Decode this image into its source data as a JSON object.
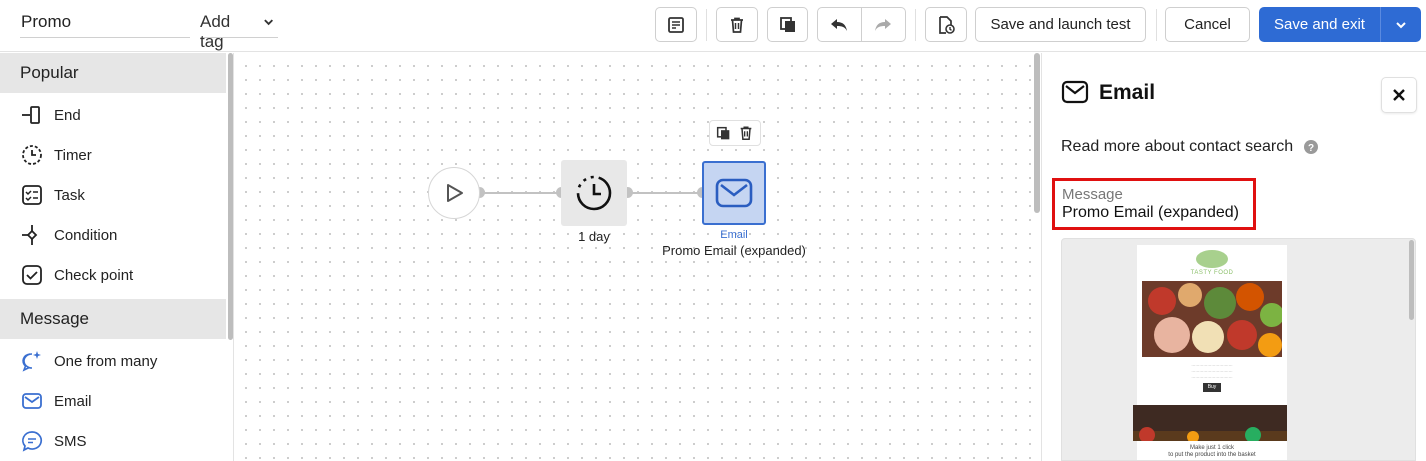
{
  "header": {
    "flow_name": "Promo",
    "add_tag_label": "Add tag",
    "save_launch_label": "Save and launch test",
    "cancel_label": "Cancel",
    "save_exit_label": "Save and exit"
  },
  "palette": {
    "sections": [
      {
        "title": "Popular",
        "items": [
          "End",
          "Timer",
          "Task",
          "Condition",
          "Check point"
        ]
      },
      {
        "title": "Message",
        "items": [
          "One from many",
          "Email",
          "SMS"
        ]
      }
    ]
  },
  "canvas": {
    "timer_label": "1 day",
    "email_type": "Email",
    "email_name": "Promo Email (expanded)"
  },
  "panel": {
    "title": "Email",
    "read_more": "Read more about contact search",
    "message_label": "Message",
    "message_value": "Promo Email (expanded)",
    "preview": {
      "brand": "TASTY FOOD",
      "button_label": "Buy",
      "footer_line1": "Make just 1 click",
      "footer_line2": "to put the product into the basket"
    }
  },
  "colors": {
    "primary": "#2e6bd4",
    "highlight": "#e01010",
    "selected_node": "#c5d5f2"
  }
}
